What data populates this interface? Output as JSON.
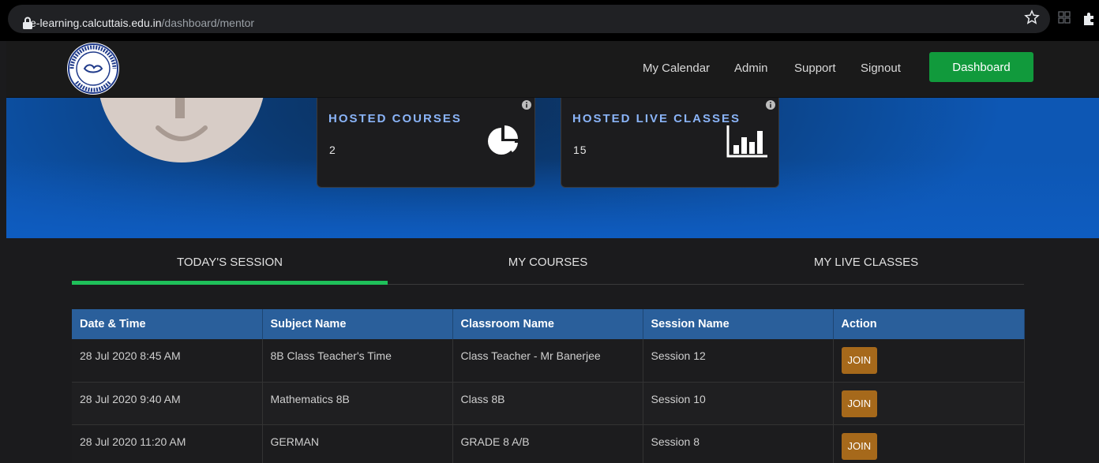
{
  "browser": {
    "url_host": "e-learning.calcuttais.edu.in",
    "url_path": "/dashboard/mentor"
  },
  "header": {
    "logo_text": "CALCUTTA INTERNATIONAL SCHOOL KOLKATA-107",
    "nav": [
      "My Calendar",
      "Admin",
      "Support",
      "Signout"
    ],
    "dashboard_label": "Dashboard"
  },
  "stats": {
    "hosted_courses": {
      "title": "HOSTED COURSES",
      "value": "2"
    },
    "hosted_live_classes": {
      "title": "HOSTED LIVE CLASSES",
      "value": "15"
    }
  },
  "tabs": [
    "TODAY'S SESSION",
    "MY COURSES",
    "MY LIVE CLASSES"
  ],
  "active_tab": "TODAY'S SESSION",
  "table": {
    "headers": [
      "Date & Time",
      "Subject Name",
      "Classroom Name",
      "Session Name",
      "Action"
    ],
    "rows": [
      {
        "date": "28 Jul 2020 8:45 AM",
        "subject": "8B Class Teacher's Time",
        "classroom": "Class Teacher - Mr Banerjee",
        "session": "Session 12",
        "action": "JOIN"
      },
      {
        "date": "28 Jul 2020 9:40 AM",
        "subject": "Mathematics 8B",
        "classroom": "Class 8B",
        "session": "Session 10",
        "action": "JOIN"
      },
      {
        "date": "28 Jul 2020 11:20 AM",
        "subject": "GERMAN",
        "classroom": "GRADE 8 A/B",
        "session": "Session 8",
        "action": "JOIN"
      }
    ]
  },
  "colors": {
    "accent_green": "#119a3c",
    "tab_underline": "#1fc05a",
    "table_header": "#2a5f9b",
    "join_button": "#a6691b",
    "hero_blue": "#0d57b4"
  },
  "icons": [
    "lock-icon",
    "star-icon",
    "apps-icon",
    "extensions-icon",
    "info-icon",
    "pie-chart-icon",
    "bar-chart-icon"
  ]
}
